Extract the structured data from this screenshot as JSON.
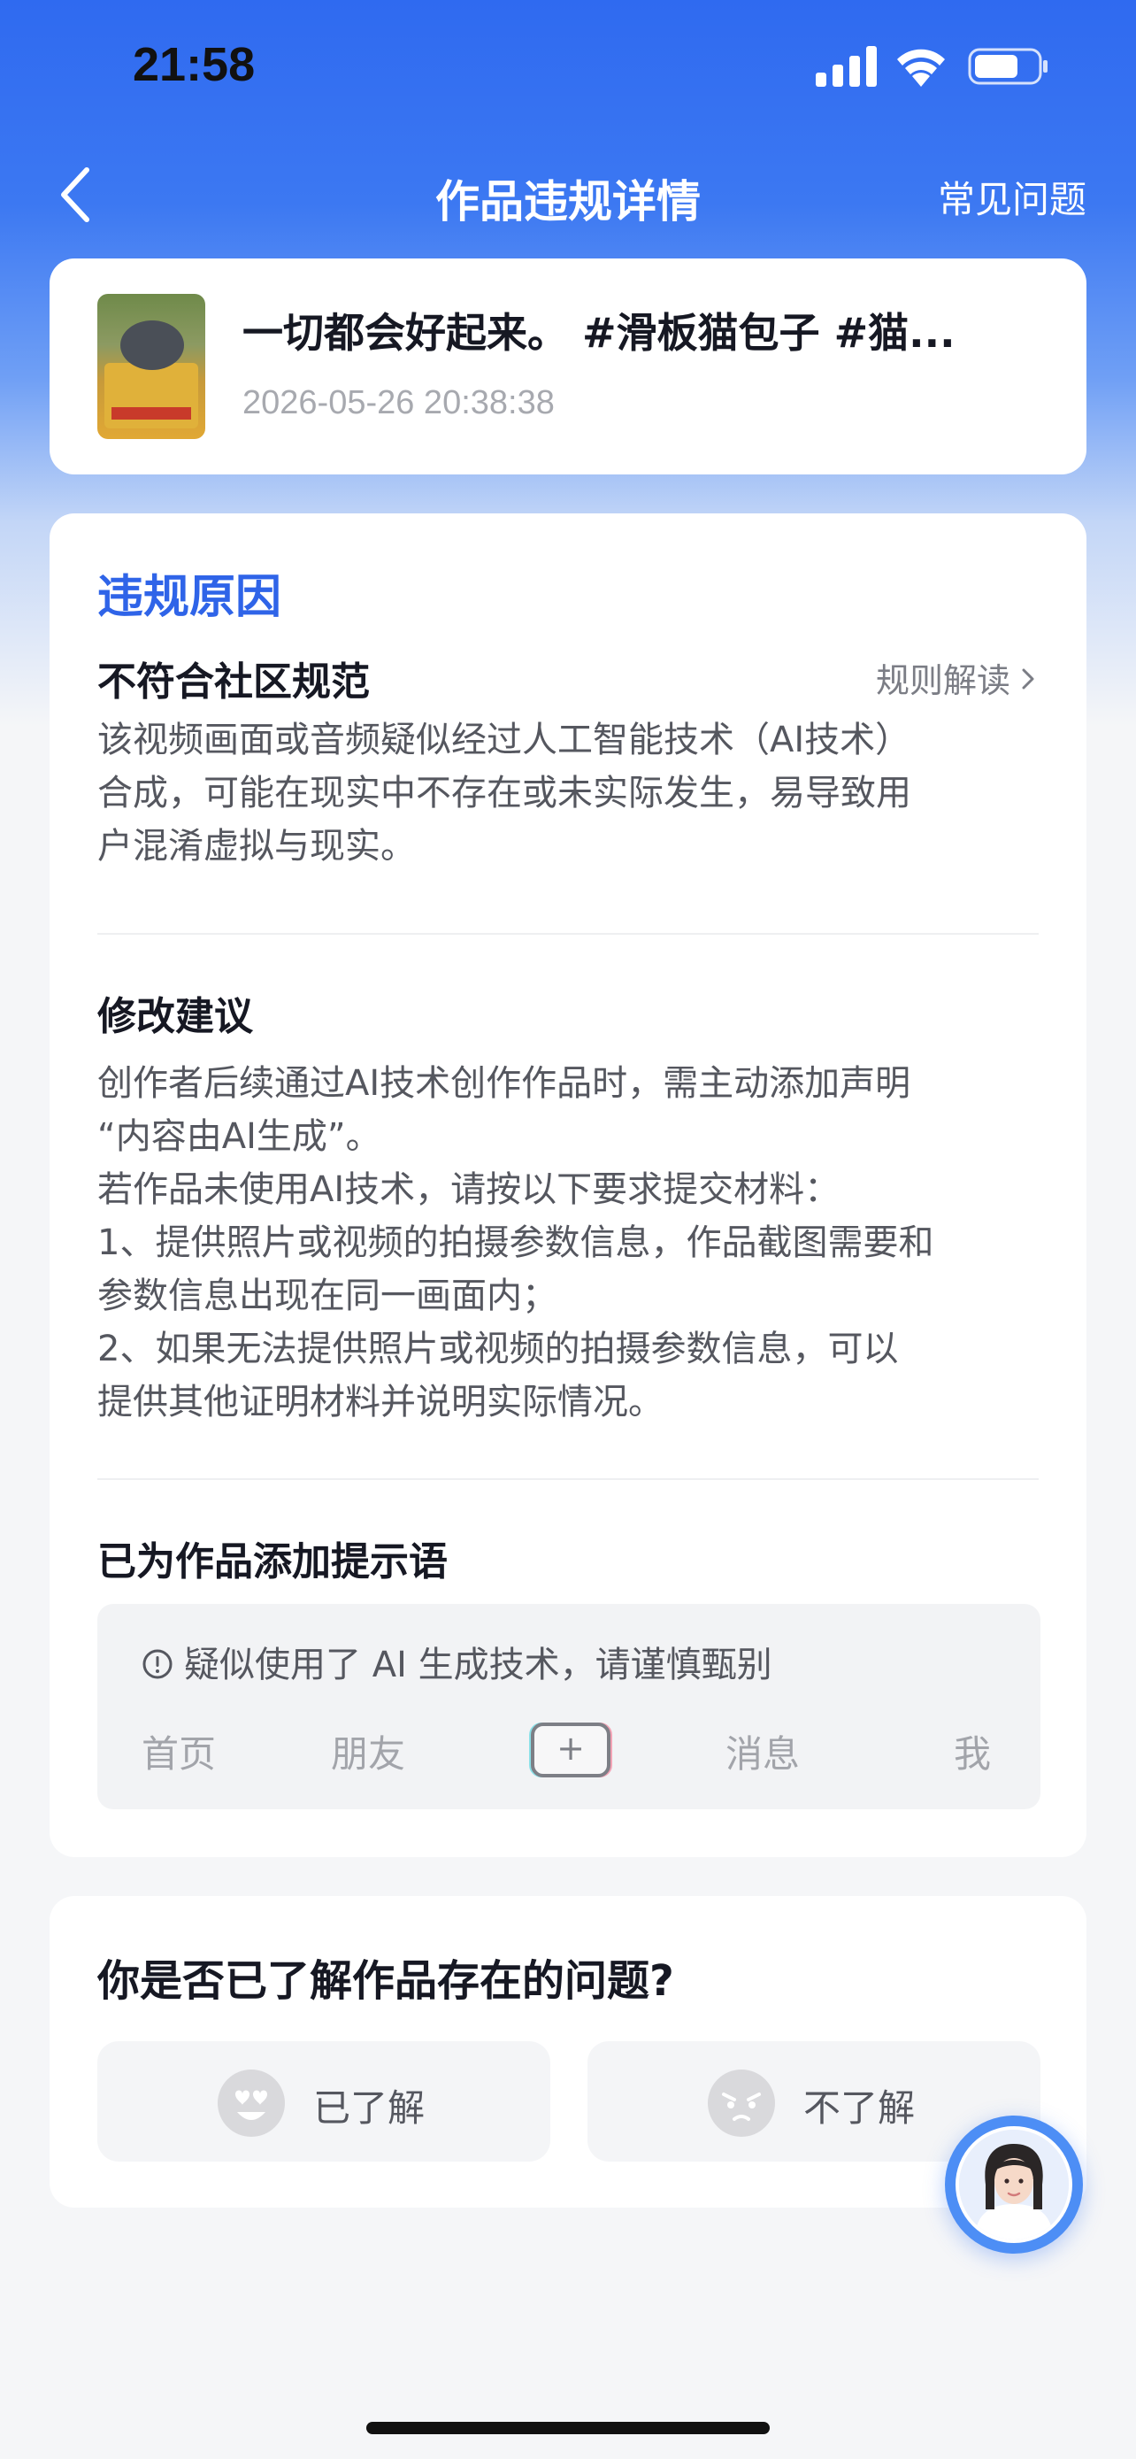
{
  "status_bar": {
    "time": "21:58"
  },
  "nav": {
    "title": "作品违规详情",
    "faq_label": "常见问题"
  },
  "work": {
    "title": "一切都会好起来。 #滑板猫包子 #猫...",
    "timestamp": "2026-05-26 20:38:38"
  },
  "violation": {
    "section_title": "违规原因",
    "reason_title": "不符合社区规范",
    "rule_link_label": "规则解读",
    "reason_text": "该视频画面或音频疑似经过人工智能技术（AI技术）\n合成，可能在现实中不存在或未实际发生，易导致用\n户混淆虚拟与现实。"
  },
  "suggestion": {
    "title": "修改建议",
    "text": "创作者后续通过AI技术创作作品时，需主动添加声明\n“内容由AI生成”。\n若作品未使用AI技术，请按以下要求提交材料：\n1、提供照片或视频的拍摄参数信息，作品截图需要和\n参数信息出现在同一画面内；\n2、如果无法提供照片或视频的拍摄参数信息，可以\n提供其他证明材料并说明实际情况。"
  },
  "hint": {
    "title": "已为作品添加提示语",
    "text": "疑似使用了 AI 生成技术，请谨慎甄别",
    "tabs": {
      "home": "首页",
      "friends": "朋友",
      "plus": "+",
      "messages": "消息",
      "me": "我"
    }
  },
  "feedback": {
    "question": "你是否已了解作品存在的问题?",
    "yes_label": "已了解",
    "no_label": "不了解"
  },
  "colors": {
    "accent": "#2f64e8",
    "header_gradient_top": "#2f6af0"
  },
  "icons": {
    "back": "chevron-left-icon",
    "info": "info-circle-icon",
    "rule_chevron": "chevron-right-icon"
  }
}
